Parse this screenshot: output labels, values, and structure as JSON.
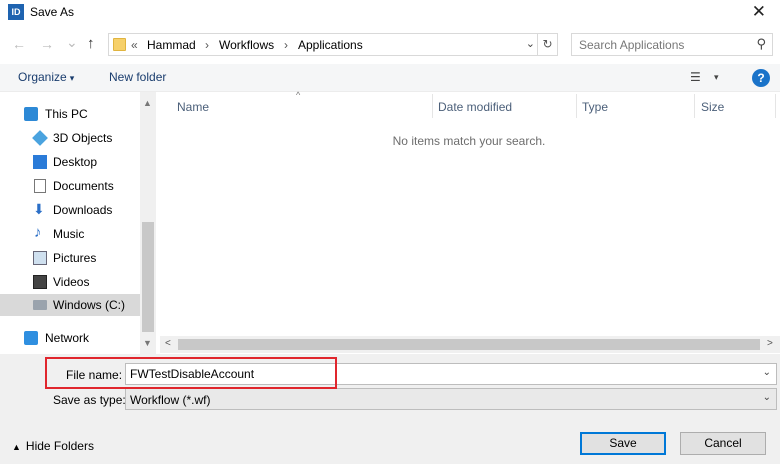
{
  "window": {
    "app_icon_text": "ID",
    "title": "Save As",
    "close_glyph": "✕"
  },
  "nav": {
    "back_glyph": "←",
    "forward_glyph": "→",
    "recent_glyph": "⌄",
    "up_glyph": "↑",
    "breadcrumb": [
      "«",
      "Hammad",
      "›",
      "Workflows",
      "›",
      "Applications"
    ],
    "dropdown_glyph": "⌄",
    "refresh_glyph": "↻",
    "search_placeholder": "Search Applications",
    "search_glyph": "⚲"
  },
  "toolbar": {
    "organize_label": "Organize",
    "organize_caret": "▾",
    "new_folder_label": "New folder",
    "view_glyph": "☰",
    "view_caret": "▾",
    "help_glyph": "?"
  },
  "sidebar": {
    "scroll_up_glyph": "▲",
    "scroll_down_glyph": "▼",
    "items": [
      {
        "label": "This PC",
        "icon": "computer-icon"
      },
      {
        "label": "3D Objects",
        "icon": "3d-objects-icon"
      },
      {
        "label": "Desktop",
        "icon": "desktop-icon"
      },
      {
        "label": "Documents",
        "icon": "documents-icon"
      },
      {
        "label": "Downloads",
        "icon": "downloads-icon"
      },
      {
        "label": "Music",
        "icon": "music-icon"
      },
      {
        "label": "Pictures",
        "icon": "pictures-icon"
      },
      {
        "label": "Videos",
        "icon": "videos-icon"
      },
      {
        "label": "Windows (C:)",
        "icon": "drive-icon",
        "selected": true
      },
      {
        "label": "Network",
        "icon": "network-icon"
      }
    ]
  },
  "filelist": {
    "columns": [
      "Name",
      "Date modified",
      "Type",
      "Size"
    ],
    "sort_glyph": "^",
    "empty_message": "No items match your search.",
    "scroll_left_glyph": "<",
    "scroll_right_glyph": ">"
  },
  "form": {
    "file_name_label": "File name:",
    "file_name_value": "FWTestDisableAccount",
    "file_name_dropdown_glyph": "⌄",
    "save_type_label": "Save as type:",
    "save_type_value": "Workflow (*.wf)",
    "save_type_dropdown_glyph": "⌄"
  },
  "footer": {
    "hide_folders_glyph": "▲",
    "hide_folders_label": "Hide Folders",
    "save_label": "Save",
    "cancel_label": "Cancel"
  },
  "colors": {
    "accent": "#0078d7",
    "highlight_outline": "#e0262d",
    "toolbar_bg": "#f5f6f7"
  }
}
